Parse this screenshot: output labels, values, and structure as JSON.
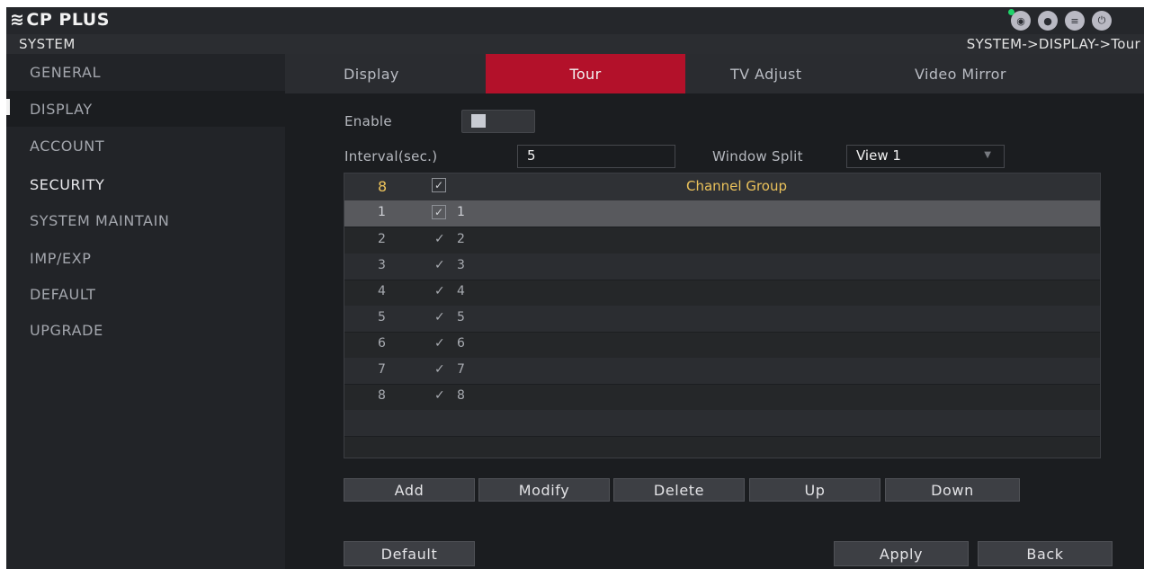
{
  "app": {
    "logo": "CP PLUS"
  },
  "header": {
    "section": "SYSTEM",
    "breadcrumb": "SYSTEM->DISPLAY->Tour"
  },
  "top_icons": [
    "eye-icon",
    "user-icon",
    "menu-icon",
    "power-icon"
  ],
  "sidebar": {
    "items": [
      {
        "label": "GENERAL"
      },
      {
        "label": "DISPLAY"
      },
      {
        "label": "ACCOUNT"
      },
      {
        "label": "SECURITY"
      },
      {
        "label": "SYSTEM MAINTAIN"
      },
      {
        "label": "IMP/EXP"
      },
      {
        "label": "DEFAULT"
      },
      {
        "label": "UPGRADE"
      }
    ],
    "active": "DISPLAY"
  },
  "tabs": [
    {
      "label": "Display"
    },
    {
      "label": "Tour"
    },
    {
      "label": "TV Adjust"
    },
    {
      "label": "Video Mirror"
    }
  ],
  "form": {
    "enable_label": "Enable",
    "interval_label": "Interval(sec.)",
    "interval_value": "5",
    "window_split_label": "Window Split",
    "window_split_value": "View 1"
  },
  "table": {
    "header_count": "8",
    "header_title": "Channel Group",
    "rows": [
      {
        "num": "1",
        "channels": "1"
      },
      {
        "num": "2",
        "channels": "2"
      },
      {
        "num": "3",
        "channels": "3"
      },
      {
        "num": "4",
        "channels": "4"
      },
      {
        "num": "5",
        "channels": "5"
      },
      {
        "num": "6",
        "channels": "6"
      },
      {
        "num": "7",
        "channels": "7"
      },
      {
        "num": "8",
        "channels": "8"
      }
    ]
  },
  "actions": {
    "add": "Add",
    "modify": "Modify",
    "delete": "Delete",
    "up": "Up",
    "down": "Down"
  },
  "footer": {
    "default": "Default",
    "apply": "Apply",
    "back": "Back"
  },
  "colors": {
    "accent": "#b3112a",
    "header_text": "#ebc25b"
  }
}
